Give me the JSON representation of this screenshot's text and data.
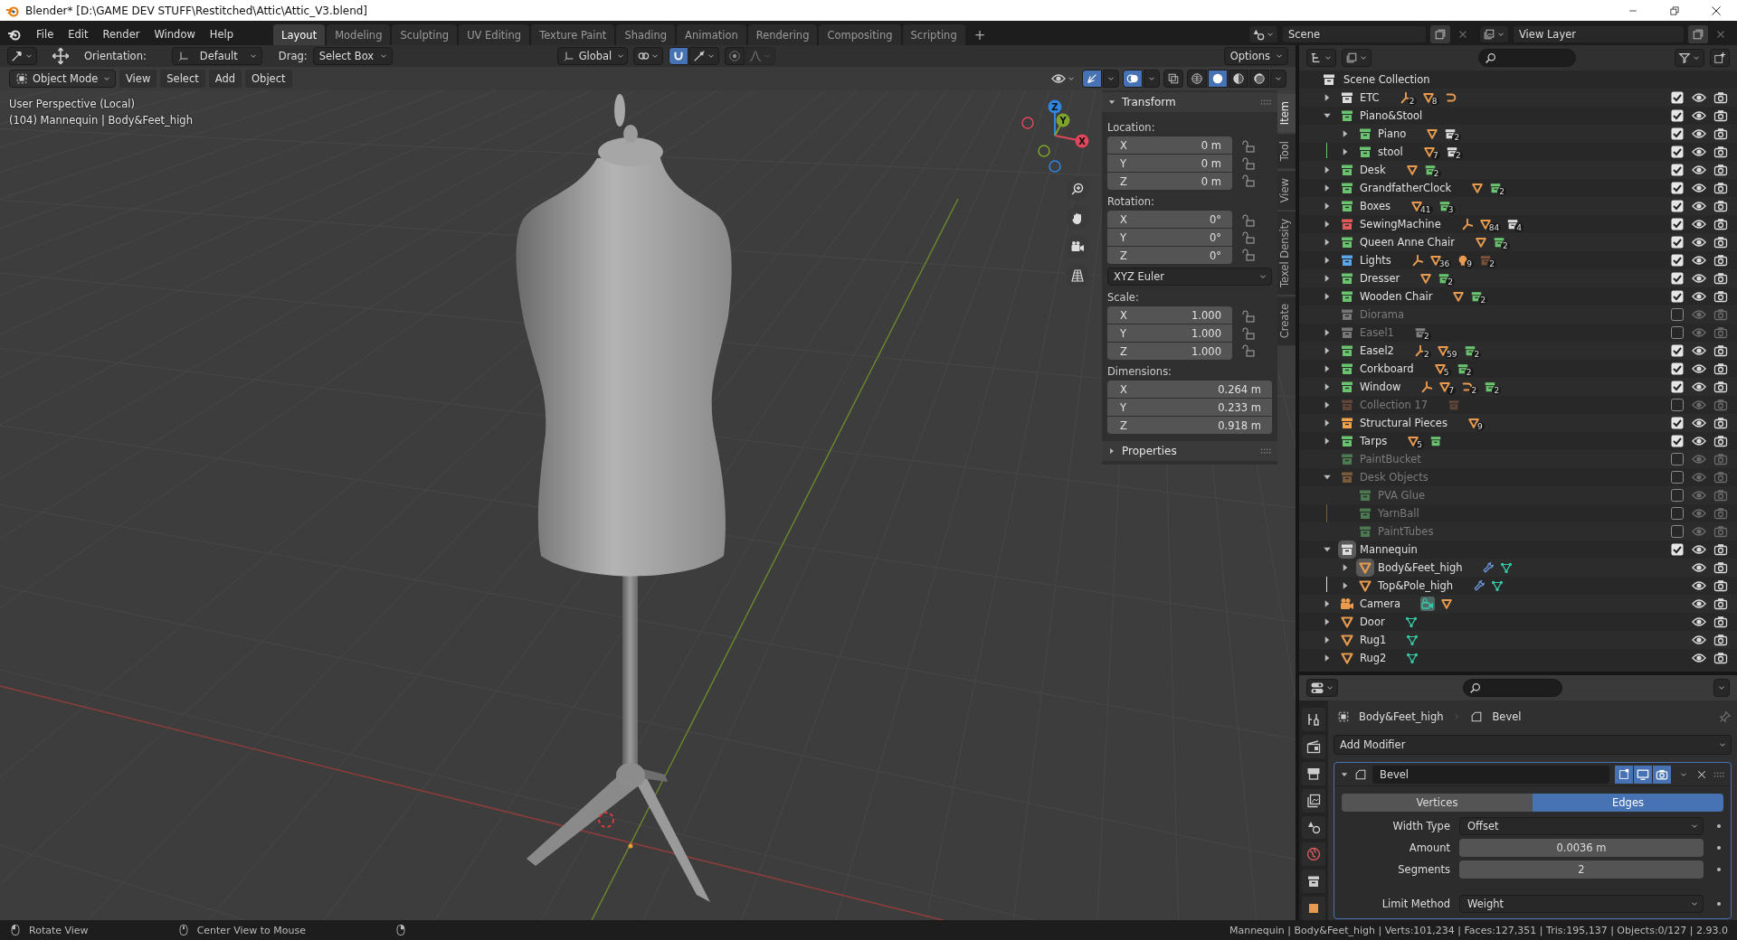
{
  "window": {
    "title": "Blender* [D:\\GAME DEV STUFF\\Restitched\\Attic\\Attic_V3.blend]"
  },
  "menu": [
    "File",
    "Edit",
    "Render",
    "Window",
    "Help"
  ],
  "workspaces": [
    {
      "label": "Layout",
      "selected": true
    },
    {
      "label": "Modeling",
      "selected": false
    },
    {
      "label": "Sculpting",
      "selected": false
    },
    {
      "label": "UV Editing",
      "selected": false
    },
    {
      "label": "Texture Paint",
      "selected": false
    },
    {
      "label": "Shading",
      "selected": false
    },
    {
      "label": "Animation",
      "selected": false
    },
    {
      "label": "Rendering",
      "selected": false
    },
    {
      "label": "Compositing",
      "selected": false
    },
    {
      "label": "Scripting",
      "selected": false
    }
  ],
  "add_workspace": "+",
  "scene": {
    "name": "Scene"
  },
  "view_layer": {
    "name": "View Layer"
  },
  "tool_header": {
    "orientation_label": "Orientation:",
    "orientation": "Default",
    "drag_label": "Drag:",
    "drag": "Select Box",
    "transform_orientation": "Global",
    "snap": true,
    "proportional_editing": false,
    "options": "Options"
  },
  "viewport_header": {
    "mode": "Object Mode",
    "menus": [
      "View",
      "Select",
      "Add",
      "Object"
    ],
    "gizmos": true,
    "overlays": true,
    "xray": false,
    "shading": [
      {
        "kind": "wireframe",
        "selected": false
      },
      {
        "kind": "solid",
        "selected": true
      },
      {
        "kind": "material",
        "selected": false
      },
      {
        "kind": "rendered",
        "selected": false
      }
    ]
  },
  "viewport": {
    "view_name": "User Perspective (Local)",
    "object_info": "(104) Mannequin | Body&Feet_high",
    "gizmo_axes": [
      {
        "label": "X",
        "color": "#e0475c"
      },
      {
        "label": "Y",
        "color": "#7ea42d"
      },
      {
        "label": "Z",
        "color": "#2f85e0"
      }
    ]
  },
  "sidebar": {
    "tabs": [
      {
        "label": "Item",
        "selected": true
      },
      {
        "label": "Tool",
        "selected": false
      },
      {
        "label": "View",
        "selected": false
      },
      {
        "label": "Texel Density",
        "selected": false
      },
      {
        "label": "Create",
        "selected": false
      }
    ],
    "panels": [
      {
        "title": "Transform",
        "expanded": true,
        "groups": [
          {
            "label": "Location:",
            "fields": [
              {
                "axis": "X",
                "value": "0 m",
                "locked": false
              },
              {
                "axis": "Y",
                "value": "0 m",
                "locked": false
              },
              {
                "axis": "Z",
                "value": "0 m",
                "locked": false
              }
            ]
          },
          {
            "label": "Rotation:",
            "mode": "XYZ Euler",
            "fields": [
              {
                "axis": "X",
                "value": "0°",
                "locked": false
              },
              {
                "axis": "Y",
                "value": "0°",
                "locked": false
              },
              {
                "axis": "Z",
                "value": "0°",
                "locked": false
              }
            ]
          },
          {
            "label": "Scale:",
            "fields": [
              {
                "axis": "X",
                "value": "1.000",
                "locked": false
              },
              {
                "axis": "Y",
                "value": "1.000",
                "locked": false
              },
              {
                "axis": "Z",
                "value": "1.000",
                "locked": false
              }
            ]
          },
          {
            "label": "Dimensions:",
            "fields": [
              {
                "axis": "X",
                "value": "0.264 m"
              },
              {
                "axis": "Y",
                "value": "0.233 m"
              },
              {
                "axis": "Z",
                "value": "0.918 m"
              }
            ]
          }
        ]
      },
      {
        "title": "Properties",
        "expanded": false
      }
    ]
  },
  "outliner": {
    "root": {
      "name": "Scene Collection",
      "children": [
        {
          "name": "ETC",
          "kind": "collection",
          "color": "#dddddd",
          "expanded": false,
          "checked": true,
          "active": false,
          "badges": [
            {
              "kind": "armature",
              "count": "2"
            },
            {
              "kind": "mesh",
              "count": "8"
            },
            {
              "kind": "curve"
            }
          ]
        },
        {
          "name": "Piano&Stool",
          "kind": "collection",
          "color": "#6ac46f",
          "expanded": true,
          "checked": true,
          "active": false,
          "children": [
            {
              "name": "Piano",
              "kind": "collection",
              "color": "#6ac46f",
              "expanded": false,
              "checked": true,
              "active": false,
              "badges": [
                {
                  "kind": "mesh"
                },
                {
                  "kind": "collection",
                  "color": "#dddddd",
                  "count": "2"
                }
              ]
            },
            {
              "name": "stool",
              "kind": "collection",
              "color": "#6ac46f",
              "expanded": false,
              "checked": true,
              "active": false,
              "badges": [
                {
                  "kind": "mesh",
                  "count": "7"
                },
                {
                  "kind": "collection",
                  "color": "#dddddd",
                  "count": "2"
                }
              ]
            }
          ]
        },
        {
          "name": "Desk",
          "kind": "collection",
          "color": "#6ac46f",
          "expanded": false,
          "checked": true,
          "active": false,
          "badges": [
            {
              "kind": "mesh"
            },
            {
              "kind": "collection",
              "color": "#6ac46f",
              "count": "2"
            }
          ]
        },
        {
          "name": "GrandfatherClock",
          "kind": "collection",
          "color": "#6ac46f",
          "expanded": false,
          "checked": true,
          "active": false,
          "badges": [
            {
              "kind": "mesh"
            },
            {
              "kind": "collection",
              "color": "#6ac46f",
              "count": "2"
            }
          ]
        },
        {
          "name": "Boxes",
          "kind": "collection",
          "color": "#6ac46f",
          "expanded": false,
          "checked": true,
          "active": false,
          "badges": [
            {
              "kind": "mesh",
              "count": "41"
            },
            {
              "kind": "collection",
              "color": "#6ac46f",
              "count": "3"
            }
          ]
        },
        {
          "name": "SewingMachine",
          "kind": "collection",
          "color": "#e05a5a",
          "expanded": false,
          "checked": true,
          "active": false,
          "badges": [
            {
              "kind": "armature"
            },
            {
              "kind": "mesh",
              "count": "84"
            },
            {
              "kind": "collection",
              "color": "#dddddd",
              "count": "4"
            }
          ]
        },
        {
          "name": "Queen Anne Chair",
          "kind": "collection",
          "color": "#6ac46f",
          "expanded": false,
          "checked": true,
          "active": false,
          "badges": [
            {
              "kind": "mesh"
            },
            {
              "kind": "collection",
              "color": "#6ac46f",
              "count": "2"
            }
          ]
        },
        {
          "name": "Lights",
          "kind": "collection",
          "color": "#5aa6e8",
          "expanded": false,
          "checked": true,
          "active": false,
          "badges": [
            {
              "kind": "armature"
            },
            {
              "kind": "mesh",
              "count": "36"
            },
            {
              "kind": "light",
              "count": "9"
            },
            {
              "kind": "collection",
              "color": "#7a5038",
              "count": "2"
            }
          ]
        },
        {
          "name": "Dresser",
          "kind": "collection",
          "color": "#6ac46f",
          "expanded": false,
          "checked": true,
          "active": false,
          "badges": [
            {
              "kind": "mesh"
            },
            {
              "kind": "collection",
              "color": "#6ac46f",
              "count": "2"
            }
          ]
        },
        {
          "name": "Wooden Chair",
          "kind": "collection",
          "color": "#6ac46f",
          "expanded": false,
          "checked": true,
          "active": false,
          "badges": [
            {
              "kind": "mesh"
            },
            {
              "kind": "collection",
              "color": "#6ac46f",
              "count": "2"
            }
          ]
        },
        {
          "name": "Diorama",
          "kind": "collection",
          "color": "#777777",
          "checked": false,
          "active": false
        },
        {
          "name": "Easel1",
          "kind": "collection",
          "color": "#777777",
          "expanded": false,
          "checked": false,
          "active": false,
          "badges": [
            {
              "kind": "collection",
              "color": "#808080",
              "count": "2"
            }
          ]
        },
        {
          "name": "Easel2",
          "kind": "collection",
          "color": "#6ac46f",
          "expanded": false,
          "checked": true,
          "active": false,
          "badges": [
            {
              "kind": "armature",
              "count": "2"
            },
            {
              "kind": "mesh",
              "count": "59"
            },
            {
              "kind": "collection",
              "color": "#6ac46f",
              "count": "2"
            }
          ]
        },
        {
          "name": "Corkboard",
          "kind": "collection",
          "color": "#6ac46f",
          "expanded": false,
          "checked": true,
          "active": false,
          "badges": [
            {
              "kind": "mesh",
              "count": "5"
            },
            {
              "kind": "collection",
              "color": "#6ac46f",
              "count": "2"
            }
          ]
        },
        {
          "name": "Window",
          "kind": "collection",
          "color": "#6ac46f",
          "expanded": false,
          "checked": true,
          "active": false,
          "badges": [
            {
              "kind": "armature"
            },
            {
              "kind": "mesh",
              "count": "7"
            },
            {
              "kind": "curve",
              "count": "2"
            },
            {
              "kind": "collection",
              "color": "#6ac46f",
              "count": "2"
            }
          ]
        },
        {
          "name": "Collection 17",
          "kind": "collection",
          "color": "#5e4538",
          "expanded": false,
          "checked": false,
          "active": false,
          "badges": [
            {
              "kind": "collection",
              "color": "#5e4538"
            }
          ]
        },
        {
          "name": "Structural Pieces",
          "kind": "collection",
          "color": "#f0a24c",
          "expanded": false,
          "checked": true,
          "active": false,
          "badges": [
            {
              "kind": "mesh",
              "count": "9"
            }
          ]
        },
        {
          "name": "Tarps",
          "kind": "collection",
          "color": "#6ac46f",
          "expanded": false,
          "checked": true,
          "active": false,
          "badges": [
            {
              "kind": "mesh",
              "count": "5"
            },
            {
              "kind": "collection",
              "color": "#6ac46f"
            }
          ]
        },
        {
          "name": "PaintBucket",
          "kind": "collection",
          "color": "#4b7a51",
          "checked": false,
          "active": false
        },
        {
          "name": "Desk Objects",
          "kind": "collection",
          "color": "#7a5a3c",
          "expanded": true,
          "checked": false,
          "active": false,
          "children": [
            {
              "name": "PVA Glue",
              "kind": "collection",
              "color": "#4b7a51",
              "checked": false,
              "active": false
            },
            {
              "name": "YarnBall",
              "kind": "collection",
              "color": "#4b7a51",
              "checked": false,
              "active": false
            },
            {
              "name": "PaintTubes",
              "kind": "collection",
              "color": "#4b7a51",
              "checked": false,
              "active": false
            }
          ]
        },
        {
          "name": "Mannequin",
          "kind": "collection",
          "color": "#dddddd",
          "expanded": true,
          "checked": true,
          "active": true,
          "children": [
            {
              "name": "Body&Feet_high",
              "kind": "mesh_object",
              "expanded": false,
              "active": true,
              "badges": [
                {
                  "kind": "modifier"
                },
                {
                  "kind": "mesh_data"
                }
              ]
            },
            {
              "name": "Top&Pole_high",
              "kind": "mesh_object",
              "expanded": false,
              "active": false,
              "badges": [
                {
                  "kind": "modifier"
                },
                {
                  "kind": "mesh_data"
                }
              ]
            }
          ]
        },
        {
          "name": "Camera",
          "kind": "camera_object",
          "expanded": false,
          "active": false,
          "badges": [
            {
              "kind": "camera_data"
            },
            {
              "kind": "mesh"
            }
          ]
        },
        {
          "name": "Door",
          "kind": "mesh_object",
          "expanded": false,
          "active": false,
          "badges": [
            {
              "kind": "mesh_data"
            }
          ]
        },
        {
          "name": "Rug1",
          "kind": "mesh_object",
          "expanded": false,
          "active": false,
          "badges": [
            {
              "kind": "mesh_data"
            }
          ]
        },
        {
          "name": "Rug2",
          "kind": "mesh_object",
          "expanded": false,
          "active": false,
          "badges": [
            {
              "kind": "mesh_data"
            }
          ]
        }
      ]
    }
  },
  "properties": {
    "tabs": [
      {
        "kind": "tool",
        "selected": false
      },
      {
        "kind": "render",
        "selected": false
      },
      {
        "kind": "output",
        "selected": false
      },
      {
        "kind": "view_layer",
        "selected": false
      },
      {
        "kind": "scene",
        "selected": false
      },
      {
        "kind": "world",
        "selected": false
      },
      {
        "kind": "collection",
        "selected": false
      },
      {
        "kind": "object",
        "selected": false
      }
    ],
    "breadcrumb": {
      "object": "Body&Feet_high",
      "modifier": "Bevel"
    },
    "add_modifier": "Add Modifier",
    "modifier": {
      "name": "Bevel",
      "expanded": true,
      "edit_mode": true,
      "show_viewport": true,
      "render": true,
      "affect": [
        {
          "label": "Vertices",
          "selected": false
        },
        {
          "label": "Edges",
          "selected": true
        }
      ],
      "props": [
        {
          "label": "Width Type",
          "kind": "dropdown",
          "value": "Offset"
        },
        {
          "label": "Amount",
          "kind": "number",
          "value": "0.0036 m"
        },
        {
          "label": "Segments",
          "kind": "number",
          "value": "2"
        },
        {
          "label": "Limit Method",
          "kind": "dropdown",
          "value": "Weight"
        }
      ]
    }
  },
  "status": {
    "hints": [
      {
        "kind": "left_mouse",
        "label": "Rotate View"
      },
      {
        "kind": "middle_mouse",
        "label": "Center View to Mouse"
      },
      {
        "kind": "right_mouse"
      }
    ],
    "stats": "Mannequin | Body&Feet_high | Verts:101,234 | Faces:127,351 | Tris:195,137 | Objects:0/127 | 2.93.0"
  }
}
